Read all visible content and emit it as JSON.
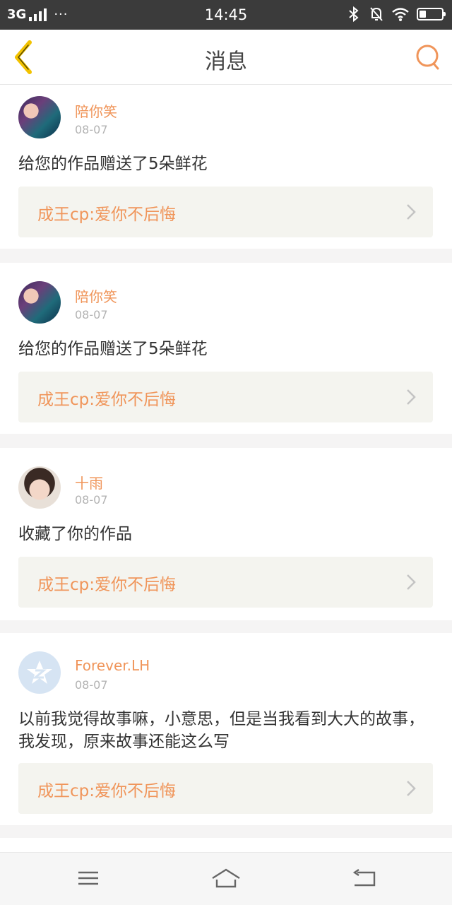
{
  "status_bar": {
    "network": "3G",
    "more": "···",
    "time": "14:45",
    "battery_level": 0.3,
    "icons": [
      "bluetooth-icon",
      "mute-icon",
      "wifi-icon",
      "battery-icon"
    ]
  },
  "header": {
    "title": "消息",
    "back_icon": "chevron-left-icon",
    "search_icon": "search-icon",
    "accent_color": "#f0955a",
    "back_color": "#f2c200"
  },
  "messages": [
    {
      "username": "陪你笑",
      "date": "08-07",
      "text": "给您的作品赠送了5朵鲜花",
      "work": "成王cp:爱你不后悔"
    },
    {
      "username": "陪你笑",
      "date": "08-07",
      "text": "给您的作品赠送了5朵鲜花",
      "work": "成王cp:爱你不后悔"
    },
    {
      "username": "十雨",
      "date": "08-07",
      "text": "收藏了你的作品",
      "work": "成王cp:爱你不后悔"
    },
    {
      "username": "Forever.LH",
      "date": "08-07",
      "text": "以前我觉得故事嘛，小意思，但是当我看到大大的故事，我发现，原来故事还能这么写",
      "work": "成王cp:爱你不后悔"
    }
  ],
  "nav": {
    "icons": [
      "menu-icon",
      "home-icon",
      "back-icon"
    ]
  }
}
